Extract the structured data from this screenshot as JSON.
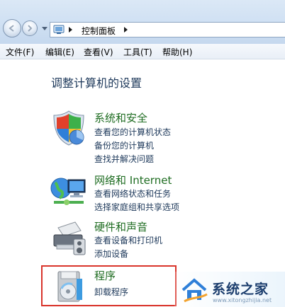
{
  "address_bar": {
    "breadcrumb": "控制面板"
  },
  "menu": {
    "items": [
      {
        "label": "文件(F)"
      },
      {
        "label": "编辑(E)"
      },
      {
        "label": "查看(V)"
      },
      {
        "label": "工具(T)"
      },
      {
        "label": "帮助(H)"
      }
    ]
  },
  "main": {
    "heading": "调整计算机的设置",
    "categories": [
      {
        "title": "系统和安全",
        "icon": "shield-icon",
        "links": [
          "查看您的计算机状态",
          "备份您的计算机",
          "查找并解决问题"
        ]
      },
      {
        "title": "网络和 Internet",
        "icon": "network-icon",
        "links": [
          "查看网络状态和任务",
          "选择家庭组和共享选项"
        ]
      },
      {
        "title": "硬件和声音",
        "icon": "printer-icon",
        "links": [
          "查看设备和打印机",
          "添加设备"
        ]
      },
      {
        "title": "程序",
        "icon": "programs-icon",
        "links": [
          "卸载程序"
        ]
      }
    ]
  },
  "watermark": {
    "text": "系统之家",
    "url": "www.xitongzhijia.net"
  },
  "colors": {
    "title_green": "#1f6d22",
    "link_blue": "#1e395b",
    "highlight_red": "#d9342b"
  }
}
